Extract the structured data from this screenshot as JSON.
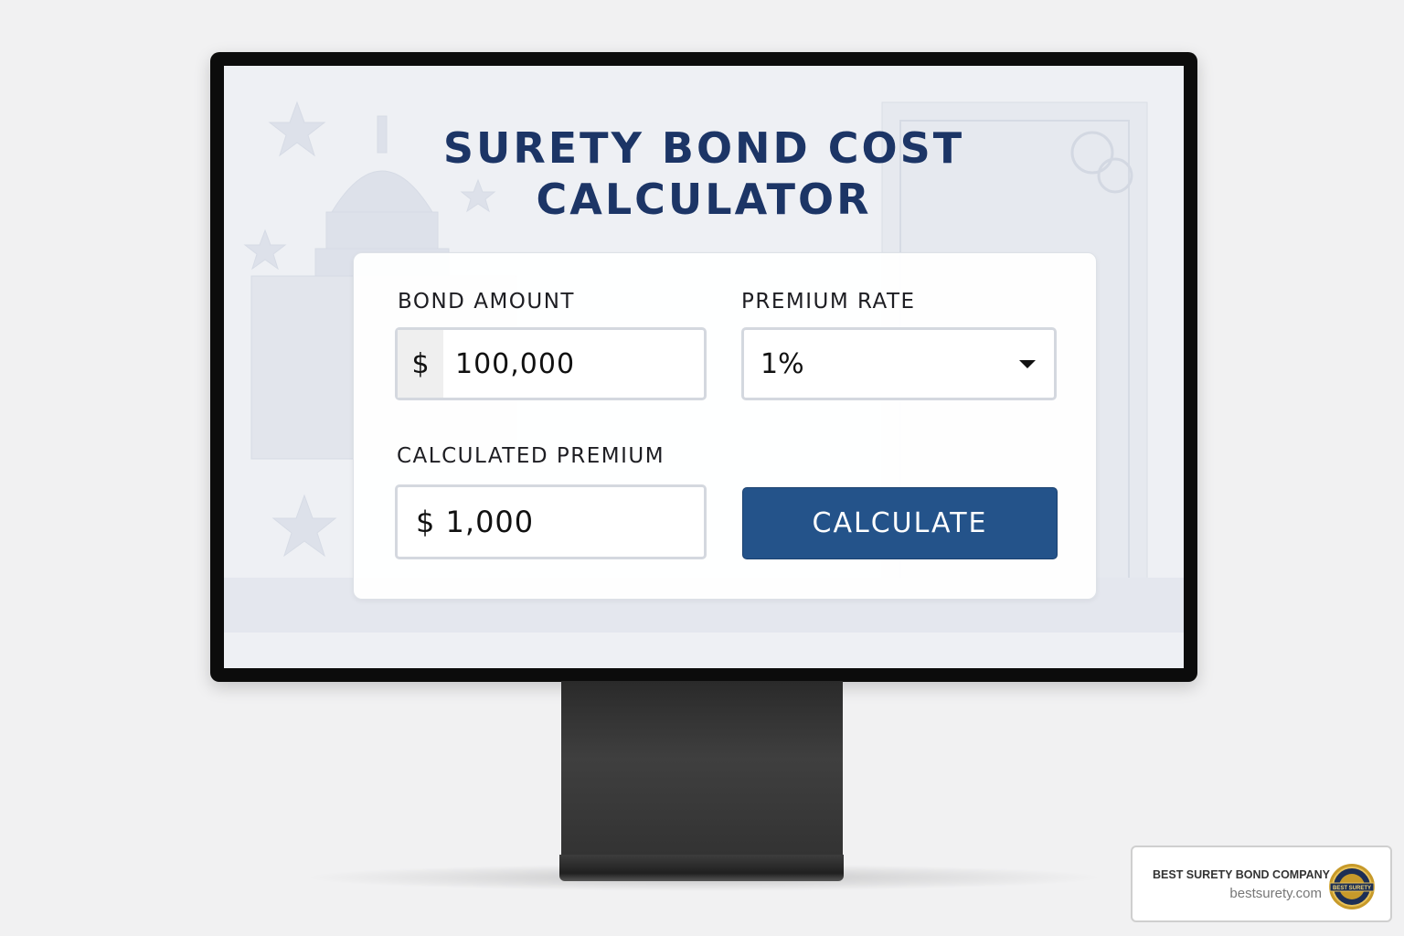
{
  "calculator": {
    "title_line1": "SURETY BOND COST",
    "title_line2": "CALCULATOR",
    "bond_amount": {
      "label": "BOND AMOUNT",
      "currency_symbol": "$",
      "value": "100,000"
    },
    "premium_rate": {
      "label": "PREMIUM RATE",
      "selected": "1%"
    },
    "calculated_premium": {
      "label": "CALCULATED PREMIUM",
      "value": "$ 1,000"
    },
    "calculate_button": "CALCULATE"
  },
  "badge": {
    "company": "BEST SURETY BOND COMPANY",
    "url": "bestsurety.com",
    "seal_text": "BEST SURETY"
  },
  "colors": {
    "title": "#1c3566",
    "button": "#24538a",
    "screen_bg": "#eef0f4"
  }
}
